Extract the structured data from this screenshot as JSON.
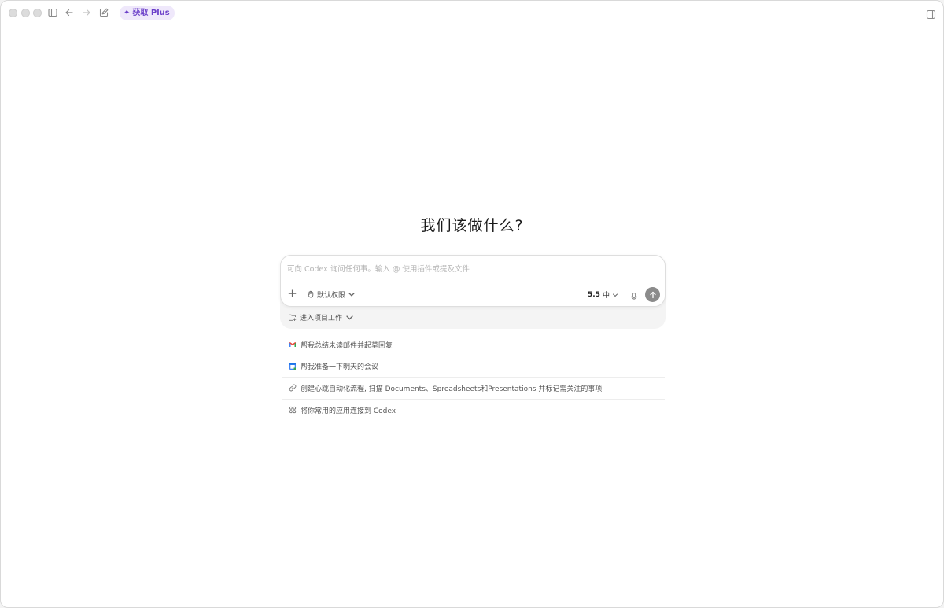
{
  "titlebar": {
    "plus_label": "获取 Plus",
    "icons": [
      "sidebar-toggle-icon",
      "back-arrow-icon",
      "forward-arrow-icon",
      "new-chat-icon",
      "panel-toggle-icon"
    ]
  },
  "main": {
    "heading": "我们该做什么?"
  },
  "composer": {
    "placeholder": "可向 Codex 询问任何事。输入 @ 使用插件或提及文件",
    "permissions_label": "默认权限",
    "model_version": "5.5",
    "model_effort": "中",
    "project_label": "进入项目工作"
  },
  "suggestions": [
    {
      "icon": "gmail-icon",
      "text": "帮我总结未读邮件并起草回复"
    },
    {
      "icon": "calendar-icon",
      "text": "帮我准备一下明天的会议"
    },
    {
      "icon": "link-icon",
      "text": "创建心跳自动化流程, 扫描 Documents、Spreadsheets和Presentations 并标记需关注的事项"
    },
    {
      "icon": "apps-icon",
      "text": "将你常用的应用连接到 Codex"
    }
  ],
  "colors": {
    "plus_bg": "#efe8fb",
    "plus_text": "#6b3fc9",
    "send_button": "#8b8b8b"
  }
}
